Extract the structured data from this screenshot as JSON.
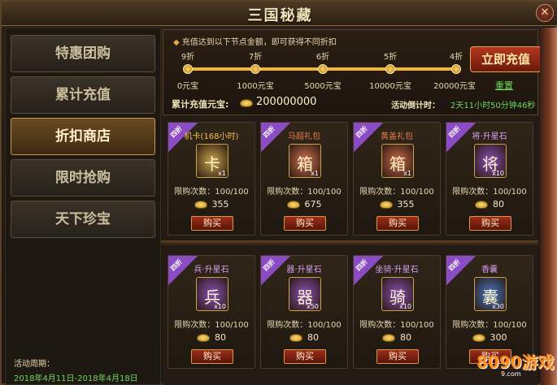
{
  "window": {
    "title": "三国秘藏",
    "close_icon": "close-icon"
  },
  "sidebar": {
    "items": [
      {
        "label": "特惠团购",
        "active": false
      },
      {
        "label": "累计充值",
        "active": false
      },
      {
        "label": "折扣商店",
        "active": true
      },
      {
        "label": "限时抢购",
        "active": false
      },
      {
        "label": "天下珍宝",
        "active": false
      }
    ],
    "period_label": "活动周期：",
    "period_value": "2018年4月11日-2018年4月18日"
  },
  "top": {
    "hint": "充值达到以下节点金额，即可获得不同折扣",
    "progress_fraction": 1.0,
    "tiers": [
      {
        "discount": "9折",
        "amount": "0元宝"
      },
      {
        "discount": "7折",
        "amount": "1000元宝"
      },
      {
        "discount": "6折",
        "amount": "5000元宝"
      },
      {
        "discount": "5折",
        "amount": "10000元宝"
      },
      {
        "discount": "4折",
        "amount": "20000元宝"
      }
    ],
    "recharge_label": "立即充值",
    "reset_label": "重置",
    "cumulative_label": "累计充值元宝:",
    "cumulative_value": "200000000",
    "countdown_label": "活动倒计时：",
    "countdown_value": "2天11小时50分钟46秒"
  },
  "items": [
    {
      "ribbon": "四折",
      "name": "机卡(168小时)",
      "name_color": "gold",
      "qty": "x1",
      "limit": "限购次数：100/100",
      "price": "355",
      "buy": "购买",
      "glyph": "卡",
      "icon_color": "#c9a24a"
    },
    {
      "ribbon": "四折",
      "name": "马超礼包",
      "name_color": "orange",
      "qty": "x1",
      "limit": "限购次数：100/100",
      "price": "675",
      "buy": "购买",
      "glyph": "箱",
      "icon_color": "#d07050"
    },
    {
      "ribbon": "四折",
      "name": "黄盖礼包",
      "name_color": "orange",
      "qty": "x1",
      "limit": "限购次数：100/100",
      "price": "355",
      "buy": "购买",
      "glyph": "箱",
      "icon_color": "#c86848"
    },
    {
      "ribbon": "四折",
      "name": "将·升星石",
      "name_color": "purple",
      "qty": "x10",
      "limit": "限购次数：100/100",
      "price": "80",
      "buy": "购买",
      "glyph": "将",
      "icon_color": "#8a50b8"
    },
    {
      "ribbon": "四折",
      "name": "兵·升星石",
      "name_color": "purple",
      "qty": "x10",
      "limit": "限购次数：100/100",
      "price": "80",
      "buy": "购买",
      "glyph": "兵",
      "icon_color": "#8a50b8"
    },
    {
      "ribbon": "四折",
      "name": "器·升星石",
      "name_color": "purple",
      "qty": "x50",
      "limit": "限购次数：100/100",
      "price": "80",
      "buy": "购买",
      "glyph": "器",
      "icon_color": "#8a50b8"
    },
    {
      "ribbon": "四折",
      "name": "坐骑·升星石",
      "name_color": "purple",
      "qty": "x10",
      "limit": "限购次数：100/100",
      "price": "80",
      "buy": "购买",
      "glyph": "骑",
      "icon_color": "#8a50b8"
    },
    {
      "ribbon": "四折",
      "name": "香囊",
      "name_color": "purple",
      "qty": "x30",
      "limit": "限购次数：100/100",
      "price": "300",
      "buy": "购买",
      "glyph": "囊",
      "icon_color": "#4a78c8"
    }
  ],
  "watermark": {
    "main": "8090游戏",
    "sub": "9.com"
  }
}
